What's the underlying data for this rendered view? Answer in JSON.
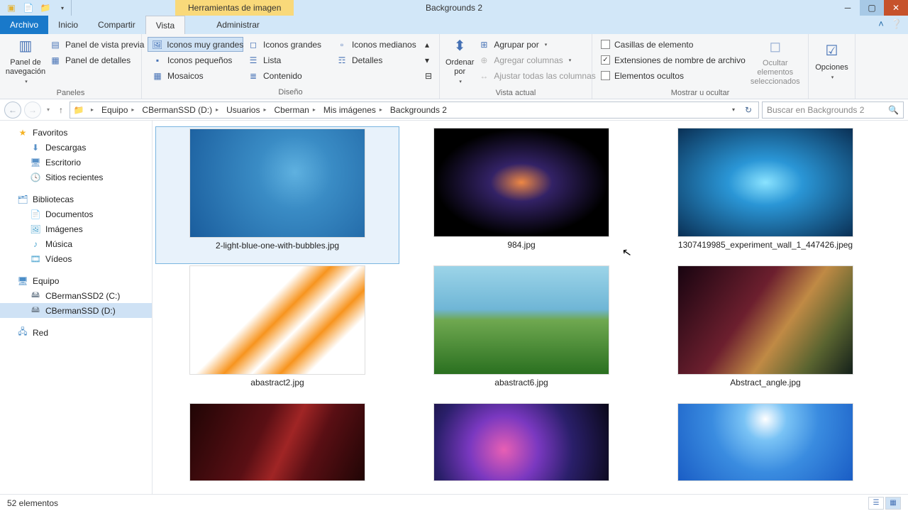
{
  "title": "Backgrounds 2",
  "contextualTab": "Herramientas de imagen",
  "tabs": {
    "file": "Archivo",
    "inicio": "Inicio",
    "compartir": "Compartir",
    "vista": "Vista",
    "administrar": "Administrar"
  },
  "ribbon": {
    "panes": {
      "navpane": "Panel de\nnavegación",
      "preview": "Panel de vista previa",
      "details": "Panel de detalles",
      "groupLabel": "Paneles"
    },
    "layout": {
      "xlarge": "Iconos muy grandes",
      "large": "Iconos grandes",
      "medium": "Iconos medianos",
      "small": "Iconos pequeños",
      "list": "Lista",
      "details": "Detalles",
      "tiles": "Mosaicos",
      "content": "Contenido",
      "groupLabel": "Diseño"
    },
    "current": {
      "sort": "Ordenar\npor",
      "group": "Agrupar por",
      "addcols": "Agregar columnas",
      "sizecols": "Ajustar todas las columnas",
      "groupLabel": "Vista actual"
    },
    "showhide": {
      "itemcheck": "Casillas de elemento",
      "fileext": "Extensiones de nombre de archivo",
      "hidden": "Elementos ocultos",
      "hidesel": "Ocultar elementos\nseleccionados",
      "groupLabel": "Mostrar u ocultar"
    },
    "options": "Opciones"
  },
  "breadcrumbs": [
    "Equipo",
    "CBermanSSD (D:)",
    "Usuarios",
    "Cberman",
    "Mis imágenes",
    "Backgrounds 2"
  ],
  "search": {
    "placeholder": "Buscar en Backgrounds 2"
  },
  "sidebar": {
    "favorites": "Favoritos",
    "favItems": [
      "Descargas",
      "Escritorio",
      "Sitios recientes"
    ],
    "libraries": "Bibliotecas",
    "libItems": [
      "Documentos",
      "Imágenes",
      "Música",
      "Vídeos"
    ],
    "computer": "Equipo",
    "drives": [
      "CBermanSSD2 (C:)",
      "CBermanSSD (D:)"
    ],
    "network": "Red"
  },
  "files": [
    "2-light-blue-one-with-bubbles.jpg",
    "984.jpg",
    "1307419985_experiment_wall_1_447426.jpeg",
    "abastract2.jpg",
    "abastract6.jpg",
    "Abstract_angle.jpg",
    "",
    "",
    ""
  ],
  "status": "52 elementos"
}
